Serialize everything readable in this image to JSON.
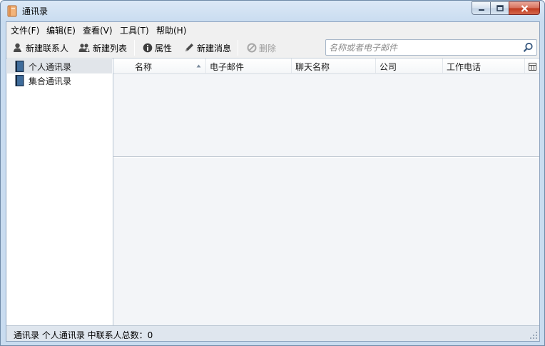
{
  "window": {
    "title": "通讯录",
    "buttons": {
      "minimize": "minimize",
      "maximize": "maximize",
      "close": "close"
    }
  },
  "menubar": {
    "items": [
      {
        "label": "文件(F)"
      },
      {
        "label": "编辑(E)"
      },
      {
        "label": "查看(V)"
      },
      {
        "label": "工具(T)"
      },
      {
        "label": "帮助(H)"
      }
    ]
  },
  "toolbar": {
    "new_contact": "新建联系人",
    "new_list": "新建列表",
    "properties": "属性",
    "new_message": "新建消息",
    "delete": "删除",
    "search_placeholder": "名称或者电子邮件"
  },
  "sidebar": {
    "books": [
      {
        "label": "个人通讯录",
        "selected": true
      },
      {
        "label": "集合通讯录",
        "selected": false
      }
    ]
  },
  "table": {
    "columns": [
      {
        "label": "名称",
        "sorted": "ascending"
      },
      {
        "label": "电子邮件"
      },
      {
        "label": "聊天名称"
      },
      {
        "label": "公司"
      },
      {
        "label": "工作电话"
      }
    ],
    "rows": []
  },
  "statusbar": {
    "text": "通讯录 个人通讯录 中联系人总数：0"
  },
  "colors": {
    "titlebar": "#c9dcf0",
    "close_button": "#c0391f",
    "selection": "#e1e5ea",
    "content_bg": "#f3f5f8"
  },
  "icons": {
    "app": "address-book-icon",
    "new_contact": "person-add-icon",
    "new_list": "group-add-icon",
    "properties": "info-icon",
    "new_message": "pencil-icon",
    "delete": "delete-icon",
    "search": "search-icon",
    "book": "book-icon",
    "column_picker": "column-picker-icon"
  }
}
